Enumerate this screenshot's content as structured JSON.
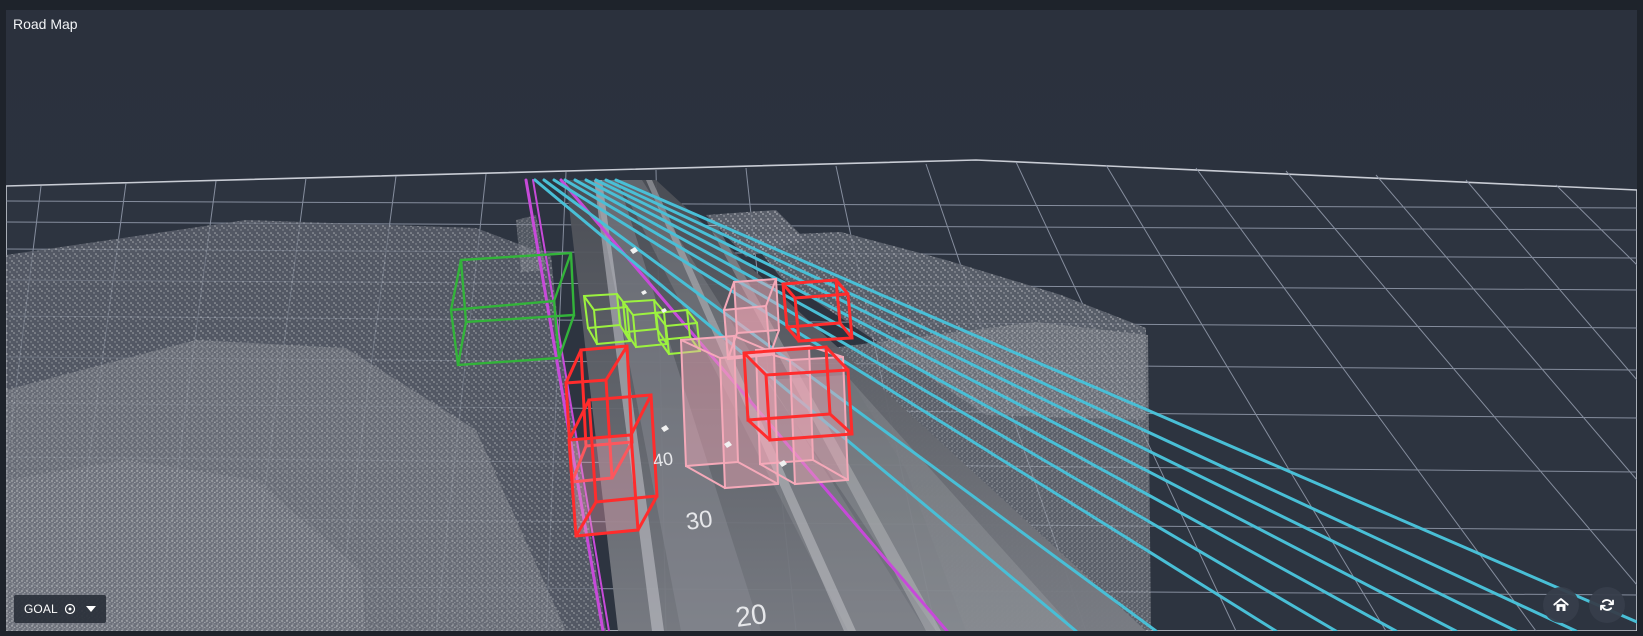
{
  "panel": {
    "title": "Road Map"
  },
  "controls": {
    "goal_label": "GOAL",
    "goal_icon": "target-icon",
    "dropdown_icon": "chevron-down-icon",
    "home_icon": "home-icon",
    "refresh_icon": "refresh-icon"
  },
  "scene": {
    "distance_labels": [
      "40",
      "30",
      "20"
    ],
    "colors": {
      "grid": "#8f97a8",
      "lane_cyan": "#49bfd6",
      "lane_magenta": "#c74ad9",
      "box_red": "#ff2c2c",
      "box_pink": "#f5a9b9",
      "box_green": "#33b33a",
      "box_lime": "#9cf23f",
      "points": "#d8d8d8"
    }
  }
}
